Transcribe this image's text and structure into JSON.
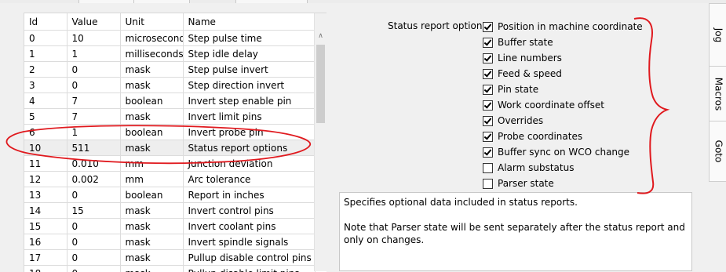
{
  "grid": {
    "columns": [
      "Id",
      "Value",
      "Unit",
      "Name"
    ],
    "rows": [
      [
        "0",
        "10",
        "microseconds",
        "Step pulse time"
      ],
      [
        "1",
        "1",
        "milliseconds",
        "Step idle delay"
      ],
      [
        "2",
        "0",
        "mask",
        "Step pulse invert"
      ],
      [
        "3",
        "0",
        "mask",
        "Step direction invert"
      ],
      [
        "4",
        "7",
        "boolean",
        "Invert step enable pin"
      ],
      [
        "5",
        "7",
        "mask",
        "Invert limit pins"
      ],
      [
        "6",
        "1",
        "boolean",
        "Invert probe pin"
      ],
      [
        "10",
        "511",
        "mask",
        "Status report options"
      ],
      [
        "11",
        "0.010",
        "mm",
        "Junction deviation"
      ],
      [
        "12",
        "0.002",
        "mm",
        "Arc tolerance"
      ],
      [
        "13",
        "0",
        "boolean",
        "Report in inches"
      ],
      [
        "14",
        "15",
        "mask",
        "Invert control pins"
      ],
      [
        "15",
        "0",
        "mask",
        "Invert coolant pins"
      ],
      [
        "16",
        "0",
        "mask",
        "Invert spindle signals"
      ],
      [
        "17",
        "0",
        "mask",
        "Pullup disable control pins"
      ],
      [
        "18",
        "0",
        "mask",
        "Pullup disable limit pins"
      ]
    ],
    "selected_row": 7
  },
  "status_options": {
    "label": "Status report options:",
    "items": [
      {
        "label": "Position in machine coordinate",
        "checked": true
      },
      {
        "label": "Buffer state",
        "checked": true
      },
      {
        "label": "Line numbers",
        "checked": true
      },
      {
        "label": "Feed & speed",
        "checked": true
      },
      {
        "label": "Pin state",
        "checked": true
      },
      {
        "label": "Work coordinate offset",
        "checked": true
      },
      {
        "label": "Overrides",
        "checked": true
      },
      {
        "label": "Probe coordinates",
        "checked": true
      },
      {
        "label": "Buffer sync on WCO change",
        "checked": true
      },
      {
        "label": "Alarm substatus",
        "checked": false
      },
      {
        "label": "Parser state",
        "checked": false
      }
    ]
  },
  "description": {
    "line1": "Specifies optional data included in status reports.",
    "line2": "Note that Parser state will be sent separately after the status report and only on changes."
  },
  "side_tabs": [
    "Jog",
    "Macros",
    "Goto"
  ],
  "colors": {
    "annotation": "#e0191e",
    "selected_row": "#eeeeee"
  }
}
